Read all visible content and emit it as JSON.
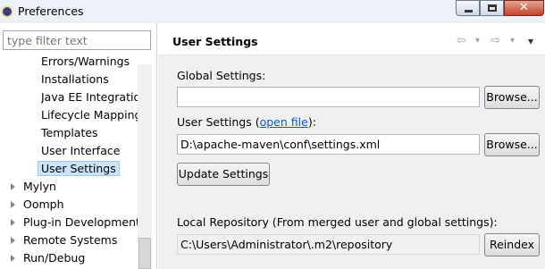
{
  "window": {
    "title": "Preferences",
    "close_glyph": "✕"
  },
  "filter": {
    "placeholder": "type filter text"
  },
  "tree": {
    "items": [
      {
        "label": "Errors/Warnings"
      },
      {
        "label": "Installations"
      },
      {
        "label": "Java EE Integration"
      },
      {
        "label": "Lifecycle Mapping"
      },
      {
        "label": "Templates"
      },
      {
        "label": "User Interface"
      },
      {
        "label": "User Settings"
      },
      {
        "label": "Mylyn"
      },
      {
        "label": "Oomph"
      },
      {
        "label": "Plug-in Development"
      },
      {
        "label": "Remote Systems"
      },
      {
        "label": "Run/Debug"
      }
    ]
  },
  "page": {
    "title": "User Settings",
    "nav": {
      "back": "⇦",
      "forward": "⇨",
      "dropdown": "▾",
      "menu": "▾"
    },
    "global": {
      "label": "Global Settings:",
      "value": "",
      "browse": "Browse..."
    },
    "user": {
      "label_prefix": "User Settings (",
      "link": "open file",
      "label_suffix": "):",
      "value": "D:\\apache-maven\\conf\\settings.xml",
      "browse": "Browse..."
    },
    "update_button": "Update Settings",
    "local": {
      "label": "Local Repository (From merged user and global settings):",
      "value": "C:\\Users\\Administrator\\.m2\\repository",
      "reindex": "Reindex"
    }
  }
}
